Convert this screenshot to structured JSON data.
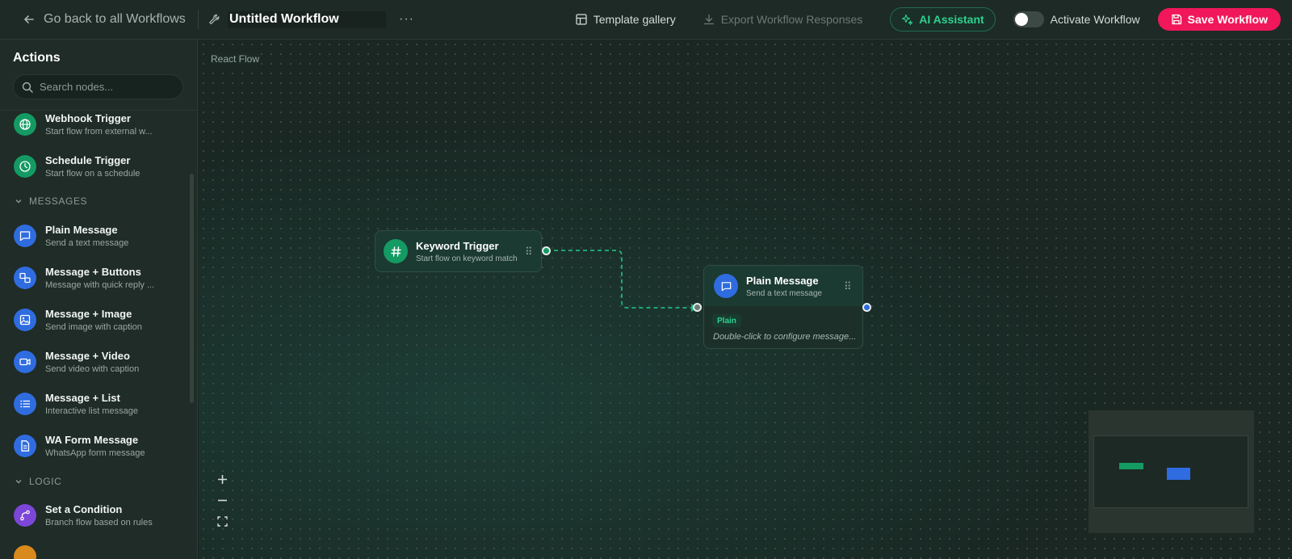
{
  "topbar": {
    "back_label": "Go back to all Workflows",
    "workflow_name": "Untitled Workflow",
    "more_label": "···",
    "template_gallery": "Template gallery",
    "export_responses": "Export Workflow Responses",
    "ai_assistant": "AI Assistant",
    "activate_label": "Activate Workflow",
    "activate_on": false,
    "save_label": "Save Workflow"
  },
  "sidebar": {
    "title": "Actions",
    "search_placeholder": "Search nodes...",
    "items": [
      {
        "title": "Webhook Trigger",
        "subtitle": "Start flow from external w...",
        "icon": "globe-icon",
        "color": "#149a63"
      },
      {
        "title": "Schedule Trigger",
        "subtitle": "Start flow on a schedule",
        "icon": "clock-icon",
        "color": "#149a63"
      },
      {
        "title": "Plain Message",
        "subtitle": "Send a text message",
        "icon": "message-icon",
        "color": "#2f6ce0"
      },
      {
        "title": "Message + Buttons",
        "subtitle": "Message with quick reply ...",
        "icon": "buttons-icon",
        "color": "#2f6ce0"
      },
      {
        "title": "Message + Image",
        "subtitle": "Send image with caption",
        "icon": "image-icon",
        "color": "#2f6ce0"
      },
      {
        "title": "Message + Video",
        "subtitle": "Send video with caption",
        "icon": "video-icon",
        "color": "#2f6ce0"
      },
      {
        "title": "Message + List",
        "subtitle": "Interactive list message",
        "icon": "list-icon",
        "color": "#2f6ce0"
      },
      {
        "title": "WA Form Message",
        "subtitle": "WhatsApp form message",
        "icon": "form-icon",
        "color": "#2f6ce0"
      },
      {
        "title": "Set a Condition",
        "subtitle": "Branch flow based on rules",
        "icon": "branch-icon",
        "color": "#7c46d8"
      }
    ],
    "sections": [
      {
        "label": "MESSAGES",
        "expanded": true
      },
      {
        "label": "LOGIC",
        "expanded": true
      }
    ]
  },
  "canvas": {
    "attribution": "React Flow",
    "nodes": [
      {
        "title": "Keyword Trigger",
        "subtitle": "Start flow on keyword match",
        "icon": "hash-icon",
        "color": "#149a63"
      },
      {
        "title": "Plain Message",
        "subtitle": "Send a text message",
        "icon": "message-icon",
        "color": "#2f6ce0",
        "badge": "Plain",
        "hint": "Double-click to configure message..."
      }
    ]
  },
  "colors": {
    "accent": "#2ed191",
    "save": "#f0175b",
    "trigger_green": "#149a63",
    "message_blue": "#2f6ce0",
    "logic_purple": "#7c46d8"
  }
}
